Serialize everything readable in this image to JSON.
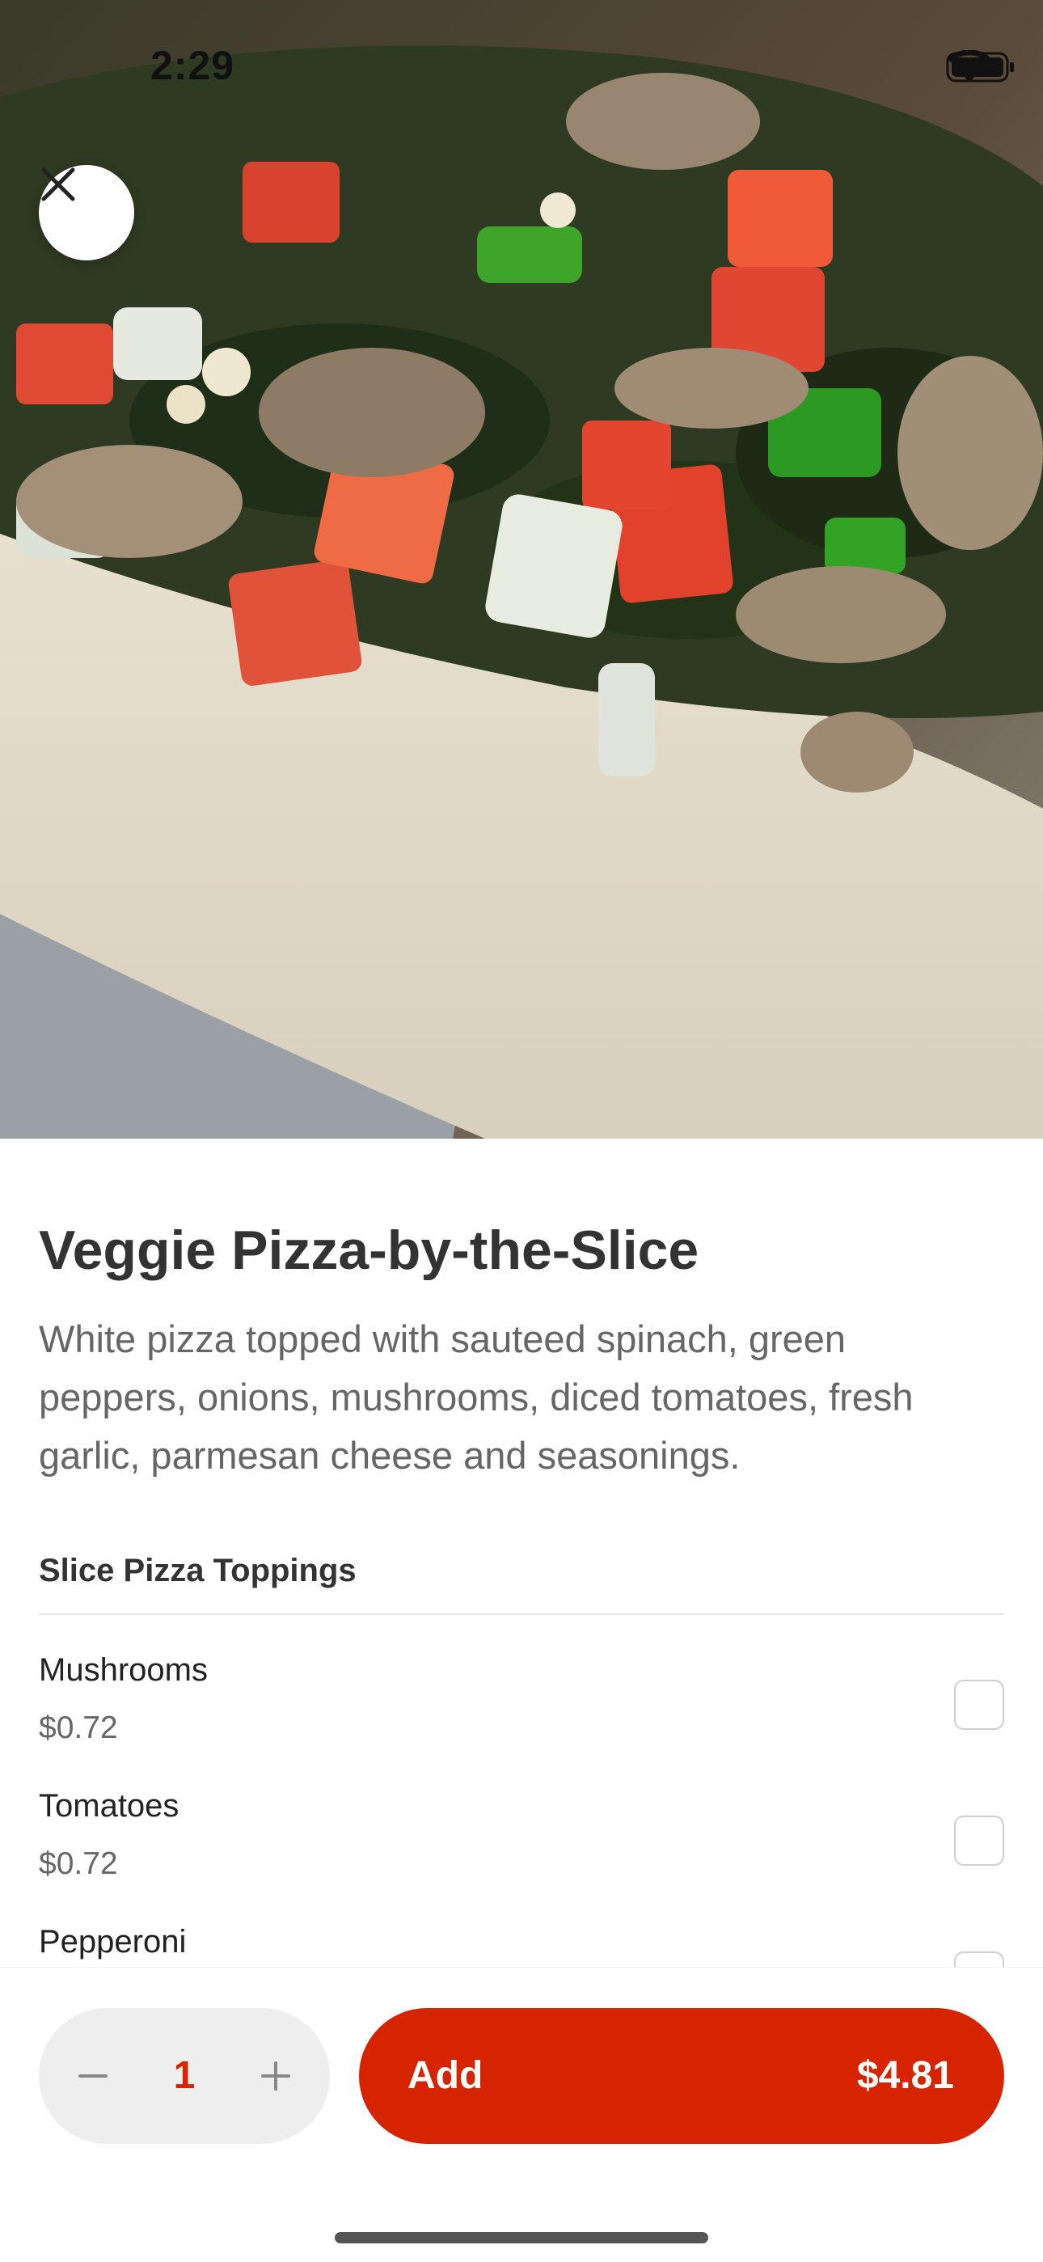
{
  "status_bar": {
    "time": "2:29"
  },
  "item": {
    "title": "Veggie Pizza-by-the-Slice",
    "description": "White pizza topped with sauteed spinach, green peppers, onions, mushrooms, diced tomatoes, fresh garlic, parmesan cheese and seasonings."
  },
  "section": {
    "title": "Slice Pizza Toppings"
  },
  "options": [
    {
      "name": "Mushrooms",
      "price": "$0.72",
      "checked": false
    },
    {
      "name": "Tomatoes",
      "price": "$0.72",
      "checked": false
    },
    {
      "name": "Pepperoni",
      "price": "",
      "checked": false
    }
  ],
  "quantity": {
    "value": "1"
  },
  "add_button": {
    "label": "Add",
    "price": "$4.81"
  },
  "colors": {
    "accent": "#d62300",
    "qty_bg": "#eeeeee",
    "text_primary": "#333333",
    "text_secondary": "#666666"
  },
  "icons": {
    "close": "close-icon",
    "minus": "minus-icon",
    "plus": "plus-icon",
    "wifi": "wifi-icon",
    "battery": "battery-icon"
  }
}
